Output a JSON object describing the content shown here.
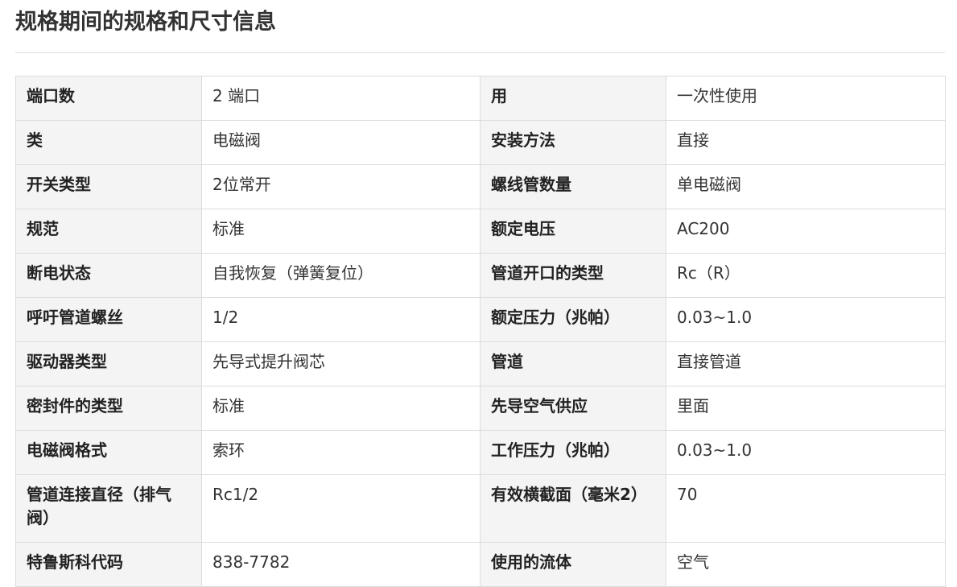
{
  "page": {
    "title": "规格期间的规格和尺寸信息"
  },
  "spec_table": {
    "rows": [
      {
        "left_label": "端口数",
        "left_value": "2 端口",
        "right_label": "用",
        "right_value": "一次性使用"
      },
      {
        "left_label": "类",
        "left_value": "电磁阀",
        "right_label": "安装方法",
        "right_value": "直接"
      },
      {
        "left_label": "开关类型",
        "left_value": "2位常开",
        "right_label": "螺线管数量",
        "right_value": "单电磁阀"
      },
      {
        "left_label": "规范",
        "left_value": "标准",
        "right_label": "额定电压",
        "right_value": "AC200"
      },
      {
        "left_label": "断电状态",
        "left_value": "自我恢复（弹簧复位）",
        "right_label": "管道开口的类型",
        "right_value": "Rc（R）"
      },
      {
        "left_label": "呼吁管道螺丝",
        "left_value": "1/2",
        "right_label": "额定压力（兆帕）",
        "right_value": "0.03~1.0"
      },
      {
        "left_label": "驱动器类型",
        "left_value": "先导式提升阀芯",
        "right_label": "管道",
        "right_value": "直接管道"
      },
      {
        "left_label": "密封件的类型",
        "left_value": "标准",
        "right_label": "先导空气供应",
        "right_value": "里面"
      },
      {
        "left_label": "电磁阀格式",
        "left_value": "索环",
        "right_label": "工作压力（兆帕）",
        "right_value": "0.03~1.0"
      },
      {
        "left_label": "管道连接直径（排气阀）",
        "left_value": "Rc1/2",
        "right_label": "有效横截面（毫米2）",
        "right_value": "70"
      },
      {
        "left_label": "特鲁斯科代码",
        "left_value": "838-7782",
        "right_label": "使用的流体",
        "right_value": "空气"
      }
    ]
  }
}
